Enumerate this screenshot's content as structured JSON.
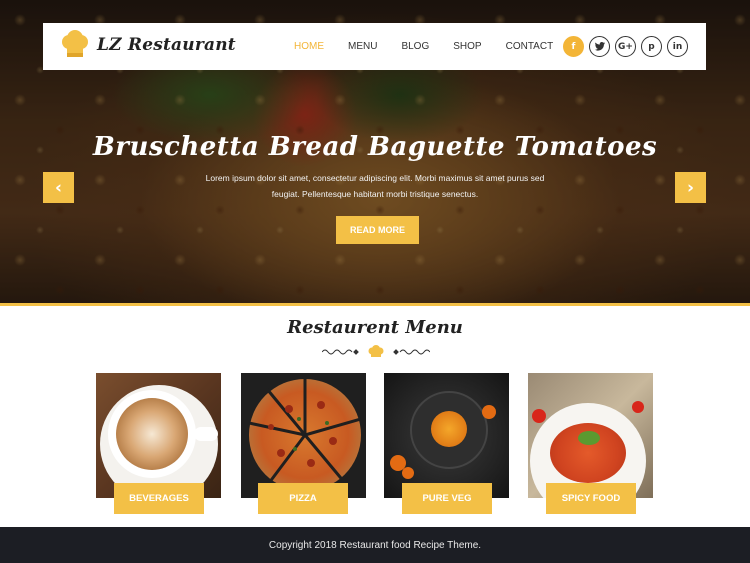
{
  "header": {
    "logo_text": "LZ Restaurant",
    "nav": [
      {
        "label": "HOME",
        "active": true
      },
      {
        "label": "MENU",
        "active": false
      },
      {
        "label": "BLOG",
        "active": false
      },
      {
        "label": "SHOP",
        "active": false
      },
      {
        "label": "CONTACT",
        "active": false
      }
    ],
    "social": [
      {
        "icon": "facebook-icon",
        "glyph": "f"
      },
      {
        "icon": "twitter-icon",
        "glyph": "t"
      },
      {
        "icon": "google-plus-icon",
        "glyph": "G+"
      },
      {
        "icon": "pinterest-icon",
        "glyph": "p"
      },
      {
        "icon": "linkedin-icon",
        "glyph": "in"
      }
    ]
  },
  "hero": {
    "title": "Bruschetta Bread Baguette Tomatoes",
    "description": "Lorem ipsum dolor sit amet, consectetur adipiscing elit. Morbi maximus sit amet purus sed feugiat. Pellentesque habitant morbi tristique senectus.",
    "button_label": "READ MORE",
    "prev_glyph": "‹",
    "next_glyph": "›"
  },
  "menu": {
    "title": "Restaurent Menu",
    "items": [
      {
        "label": "BEVERAGES"
      },
      {
        "label": "PIZZA"
      },
      {
        "label": "PURE VEG"
      },
      {
        "label": "SPICY FOOD"
      }
    ]
  },
  "footer": {
    "copyright": "Copyright 2018 Restaurant food Recipe Theme."
  },
  "colors": {
    "accent": "#f3c046",
    "nav_active": "#f3b537",
    "footer_bg": "#1c1e24"
  }
}
